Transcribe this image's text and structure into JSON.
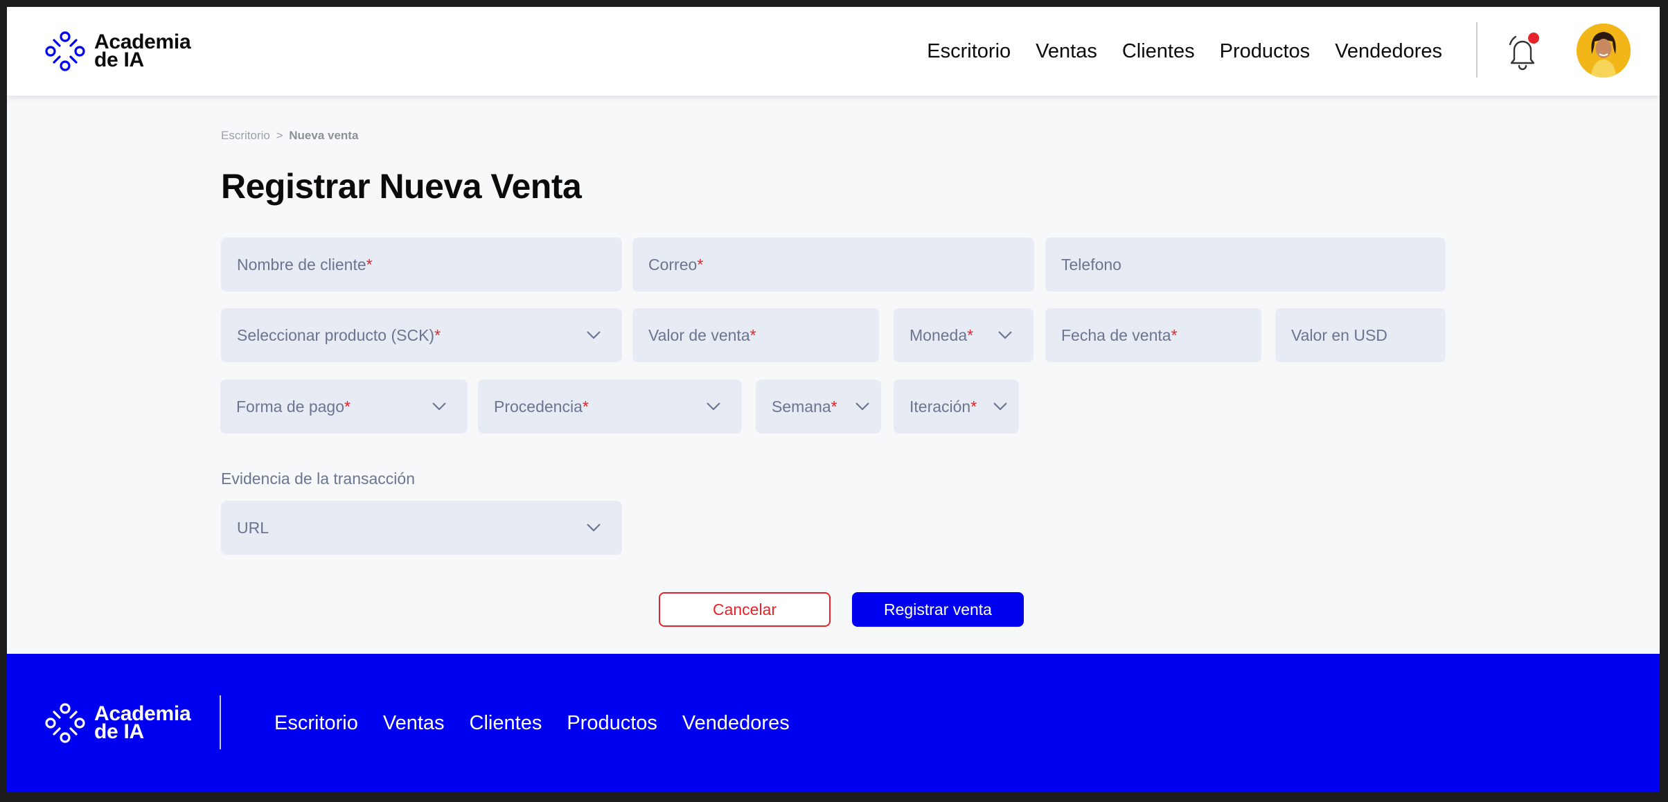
{
  "brand": {
    "line1": "Academia",
    "line2": "de IA"
  },
  "nav": [
    "Escritorio",
    "Ventas",
    "Clientes",
    "Productos",
    "Vendedores"
  ],
  "breadcrumb": {
    "parent": "Escritorio",
    "separator": ">",
    "current": "Nueva venta"
  },
  "title": {
    "light": "Registrar",
    "bold": "Nueva Venta"
  },
  "form": {
    "nombre": {
      "placeholder": "Nombre  de cliente",
      "required": "*"
    },
    "correo": {
      "placeholder": "Correo",
      "required": "*"
    },
    "telefono": {
      "placeholder": "Telefono"
    },
    "producto": {
      "placeholder": "Seleccionar producto (SCK)",
      "required": "*"
    },
    "valor_venta": {
      "placeholder": "Valor de venta",
      "required": "*"
    },
    "moneda": {
      "placeholder": "Moneda",
      "required": "*"
    },
    "fecha_venta": {
      "placeholder": "Fecha de venta",
      "required": "*"
    },
    "valor_usd": {
      "placeholder": "Valor en USD"
    },
    "forma_pago": {
      "placeholder": "Forma de pago",
      "required": "*"
    },
    "procedencia": {
      "placeholder": "Procedencia",
      "required": "*"
    },
    "semana": {
      "placeholder": "Semana",
      "required": "*"
    },
    "iteracion": {
      "placeholder": "Iteración",
      "required": "*"
    },
    "evidencia_label": "Evidencia de la transacción",
    "evidencia": {
      "placeholder": "URL"
    }
  },
  "buttons": {
    "cancel": "Cancelar",
    "submit": "Registrar venta"
  },
  "colors": {
    "primary": "#0000f0",
    "required": "#e4232a",
    "field_bg": "#e7ebf3",
    "page_bg": "#f7f8fa"
  },
  "icons": [
    "logo-icon",
    "bell-icon",
    "chevron-down-icon",
    "avatar"
  ]
}
